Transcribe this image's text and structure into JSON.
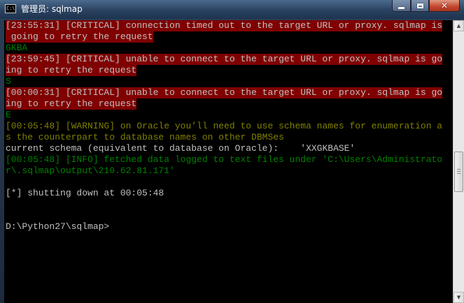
{
  "window": {
    "title": "管理员: sqlmap",
    "icon": "cmd-console-icon",
    "icon_text": "C:\\"
  },
  "controls": {
    "minimize": "minimize-icon",
    "maximize": "maximize-icon",
    "close": "close-icon",
    "close_glyph": "✕"
  },
  "console": {
    "lines": [
      {
        "style": "crit",
        "text": "[23:55:31] [CRITICAL] connection timed out to the target URL or proxy. sqlmap is"
      },
      {
        "style": "crit",
        "text": " going to retry the request"
      },
      {
        "style": "grn",
        "text": "GKBA"
      },
      {
        "style": "crit",
        "text": "[23:59:45] [CRITICAL] unable to connect to the target URL or proxy. sqlmap is go"
      },
      {
        "style": "crit",
        "text": "ing to retry the request"
      },
      {
        "style": "grn",
        "text": "S"
      },
      {
        "style": "crit",
        "text": "[00:00:31] [CRITICAL] unable to connect to the target URL or proxy. sqlmap is go"
      },
      {
        "style": "crit",
        "text": "ing to retry the request"
      },
      {
        "style": "grn",
        "text": "E"
      },
      {
        "style": "warn",
        "text": "[00:05:48] [WARNING] on Oracle you’ll need to use schema names for enumeration a"
      },
      {
        "style": "warn",
        "text": "s the counterpart to database names on other DBMSes"
      },
      {
        "style": "plain",
        "text": "current schema (equivalent to database on Oracle):    'XXGKBASE'"
      },
      {
        "style": "info",
        "text": "[00:05:48] [INFO] fetched data logged to text files under 'C:\\Users\\Administrato"
      },
      {
        "style": "info",
        "text": "r\\.sqlmap\\output\\210.62.81.171'"
      },
      {
        "style": "plain",
        "text": ""
      },
      {
        "style": "plain",
        "text": "[*] shutting down at 00:05:48"
      },
      {
        "style": "plain",
        "text": ""
      },
      {
        "style": "plain",
        "text": ""
      },
      {
        "style": "plain",
        "text": "D:\\Python27\\sqlmap>"
      }
    ]
  },
  "scrollbar": {
    "up_glyph": "▲",
    "down_glyph": "▼"
  }
}
